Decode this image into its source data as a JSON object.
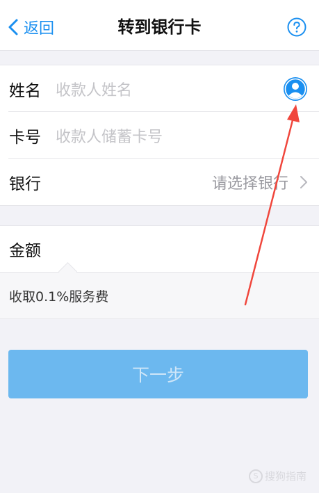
{
  "nav": {
    "back_label": "返回",
    "title": "转到银行卡"
  },
  "form": {
    "name": {
      "label": "姓名",
      "placeholder": "收款人姓名"
    },
    "card": {
      "label": "卡号",
      "placeholder": "收款人储蓄卡号"
    },
    "bank": {
      "label": "银行",
      "value": "请选择银行"
    }
  },
  "amount": {
    "label": "金额",
    "fee_note": "收取0.1%服务费"
  },
  "next_button": {
    "label": "下一步"
  },
  "watermark": {
    "logo_char": "S",
    "text": "搜狗指南"
  },
  "colors": {
    "accent": "#1a8ff0",
    "button": "#6cb8ef",
    "annotation_arrow": "#f0463c"
  }
}
